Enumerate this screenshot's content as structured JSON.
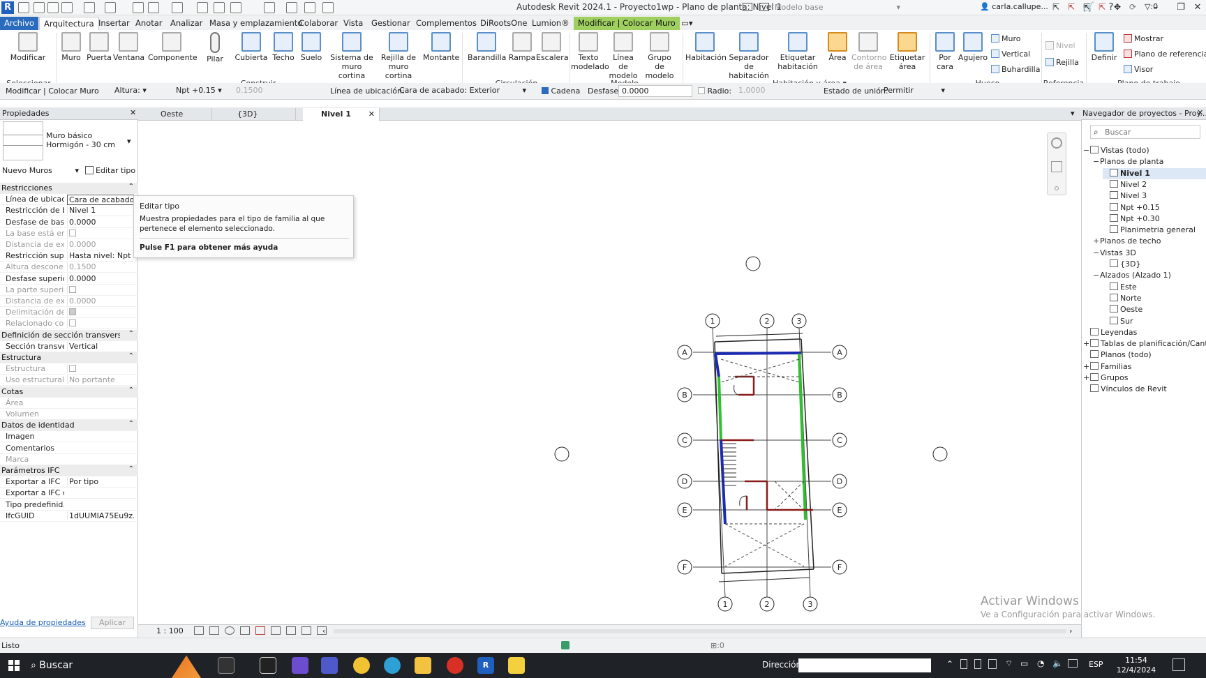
{
  "titlebar": {
    "title": "Autodesk Revit 2024.1 - Proyecto1wp - Plano de planta: Nivel 1",
    "user": "carla.callupe...",
    "logo": "R"
  },
  "menu": {
    "file": "Archivo",
    "tabs": [
      "Arquitectura",
      "Insertar",
      "Anotar",
      "Analizar",
      "Masa y emplazamiento",
      "Colaborar",
      "Vista",
      "Gestionar",
      "Complementos",
      "DiRootsOne",
      "Lumion®"
    ],
    "context_tab": "Modificar | Colocar Muro"
  },
  "ribbon": {
    "buttons": {
      "modificar": "Modificar",
      "muro": "Muro",
      "puerta": "Puerta",
      "ventana": "Ventana",
      "componente": "Componente",
      "pilar": "Pilar",
      "cubierta": "Cubierta",
      "techo": "Techo",
      "suelo": "Suelo",
      "sistema_muro": "Sistema de muro cortina",
      "rejilla_muro": "Rejilla de muro cortina",
      "montante": "Montante",
      "barandilla": "Barandilla",
      "rampa": "Rampa",
      "escalera": "Escalera",
      "texto_modelado": "Texto modelado",
      "linea_modelo": "Línea de modelo",
      "grupo_modelo": "Grupo de modelo",
      "habitacion": "Habitación",
      "separador": "Separador de habitación",
      "etiquetar_hab": "Etiquetar habitación",
      "area": "Área",
      "contorno_area": "Contorno de área",
      "etiquetar_area": "Etiquetar área",
      "por_cara": "Por cara",
      "agujero": "Agujero",
      "muro_small": "Muro",
      "vertical": "Vertical",
      "buhardilla": "Buhardilla",
      "nivel": "Nivel",
      "rejilla": "Rejilla",
      "definir": "Definir",
      "mostrar": "Mostrar",
      "plano_ref": "Plano de referencia",
      "visor": "Visor"
    },
    "panels": {
      "seleccionar": "Seleccionar",
      "construir": "Construir",
      "circulacion": "Circulación",
      "modelo": "Modelo",
      "habitacion_area": "Habitación y área",
      "hueco": "Hueco",
      "referencia": "Referencia",
      "plano_trabajo": "Plano de trabajo"
    }
  },
  "options": {
    "mode": "Modificar | Colocar Muro",
    "altura_label": "Altura:",
    "altura_value": "Npt +0.15",
    "height_value": "0.1500",
    "linea_label": "Línea de ubicación:",
    "linea_value": "Cara de acabado: Exterior",
    "cadena_label": "Cadena",
    "desfase_label": "Desfase:",
    "desfase_value": "0.0000",
    "radio_label": "Radio:",
    "radio_value": "1.0000",
    "union_label": "Estado de unión:",
    "union_value": "Permitir"
  },
  "properties": {
    "title": "Propiedades",
    "type_family": "Muro básico",
    "type_name": "Hormigón - 30 cm",
    "filter": "Nuevo Muros",
    "edit_type": "Editar tipo",
    "rows": [
      {
        "kind": "sec",
        "k": "Restricciones"
      },
      {
        "k": "Línea de ubicac...",
        "v": "Cara de acabado"
      },
      {
        "k": "Restricción de b...",
        "v": "Nivel 1"
      },
      {
        "k": "Desfase de base",
        "v": "0.0000"
      },
      {
        "k": "La base está enl...",
        "v": "",
        "cb": true,
        "dim": true
      },
      {
        "k": "Distancia de ext...",
        "v": "0.0000",
        "dim": true
      },
      {
        "k": "Restricción sup...",
        "v": "Hasta nivel: Npt ..."
      },
      {
        "k": "Altura descone...",
        "v": "0.1500",
        "dim": true
      },
      {
        "k": "Desfase superior",
        "v": "0.0000"
      },
      {
        "k": "La parte superio...",
        "v": "",
        "cb": true,
        "dim": true
      },
      {
        "k": "Distancia de ext...",
        "v": "0.0000",
        "dim": true
      },
      {
        "k": "Delimitación de...",
        "v": "",
        "cb": true,
        "dim": true
      },
      {
        "k": "Relacionado co...",
        "v": "",
        "cb": true,
        "dim": true
      },
      {
        "kind": "sec",
        "k": "Definición de sección transversal"
      },
      {
        "k": "Sección transve...",
        "v": "Vertical"
      },
      {
        "kind": "sec",
        "k": "Estructura"
      },
      {
        "k": "Estructura",
        "v": "",
        "cb": true,
        "dim": true
      },
      {
        "k": "Uso estructural",
        "v": "No portante",
        "dim": true
      },
      {
        "kind": "sec",
        "k": "Cotas"
      },
      {
        "k": "Área",
        "v": "",
        "dim": true
      },
      {
        "k": "Volumen",
        "v": "",
        "dim": true
      },
      {
        "kind": "sec",
        "k": "Datos de identidad"
      },
      {
        "k": "Imagen",
        "v": ""
      },
      {
        "k": "Comentarios",
        "v": ""
      },
      {
        "k": "Marca",
        "v": "",
        "dim": true
      },
      {
        "kind": "sec",
        "k": "Parámetros IFC"
      },
      {
        "k": "Exportar a IFC",
        "v": "Por tipo"
      },
      {
        "k": "Exportar a IFC c...",
        "v": ""
      },
      {
        "k": "Tipo predefinid...",
        "v": ""
      },
      {
        "k": "IfcGUID",
        "v": "1dUUMIA75Eu9z..."
      }
    ],
    "help_link": "Ayuda de propiedades",
    "apply": "Aplicar"
  },
  "tooltip": {
    "title": "Editar tipo",
    "body": "Muestra propiedades para el tipo de familia al que pertenece el elemento seleccionado.",
    "help": "Pulse F1 para obtener más ayuda"
  },
  "view_tabs": [
    "Oeste",
    "{3D}",
    "Nivel 1"
  ],
  "grids": {
    "cols_top": [
      "1",
      "2",
      "3"
    ],
    "cols_bottom": [
      "1",
      "2",
      "3"
    ],
    "rows": [
      "A",
      "B",
      "C",
      "D",
      "E",
      "F"
    ]
  },
  "browser": {
    "title": "Navegador de proyectos - Proy...",
    "search_placeholder": "Buscar",
    "nodes": [
      {
        "t": "Vistas (todo)",
        "d": 0,
        "pm": "−",
        "icon": true
      },
      {
        "t": "Planos de planta",
        "d": 1,
        "pm": "−"
      },
      {
        "t": "Nivel 1",
        "d": 2,
        "icon": true,
        "sel": true
      },
      {
        "t": "Nivel 2",
        "d": 2,
        "icon": true
      },
      {
        "t": "Nivel 3",
        "d": 2,
        "icon": true
      },
      {
        "t": "Npt +0.15",
        "d": 2,
        "icon": true
      },
      {
        "t": "Npt +0.30",
        "d": 2,
        "icon": true
      },
      {
        "t": "Planimetria general",
        "d": 2,
        "icon": true
      },
      {
        "t": "Planos de techo",
        "d": 1,
        "pm": "+"
      },
      {
        "t": "Vistas 3D",
        "d": 1,
        "pm": "−"
      },
      {
        "t": "{3D}",
        "d": 2,
        "icon": true
      },
      {
        "t": "Alzados (Alzado 1)",
        "d": 1,
        "pm": "−"
      },
      {
        "t": "Este",
        "d": 2,
        "icon": true
      },
      {
        "t": "Norte",
        "d": 2,
        "icon": true
      },
      {
        "t": "Oeste",
        "d": 2,
        "icon": true
      },
      {
        "t": "Sur",
        "d": 2,
        "icon": true
      },
      {
        "t": "Leyendas",
        "d": 0,
        "icon": true
      },
      {
        "t": "Tablas de planificación/Cantid",
        "d": 0,
        "pm": "+",
        "icon": true
      },
      {
        "t": "Planos (todo)",
        "d": 0,
        "icon": true
      },
      {
        "t": "Familias",
        "d": 0,
        "pm": "+",
        "icon": true
      },
      {
        "t": "Grupos",
        "d": 0,
        "pm": "+",
        "icon": true
      },
      {
        "t": "Vínculos de Revit",
        "d": 0,
        "icon": true
      }
    ]
  },
  "viewcontrol": {
    "scale": "1 : 100"
  },
  "status": {
    "left": "Listo",
    "zero1": ":0",
    "model": "Modelo base",
    "zero2": ":0"
  },
  "watermark": {
    "line1": "Activar Windows",
    "line2": "Ve a Configuración para activar Windows."
  },
  "taskbar": {
    "search": "Buscar",
    "direccion": "Dirección",
    "lang": "ESP",
    "time": "11:54",
    "date": "12/4/2024"
  },
  "colors": {
    "wall_blue": "#1a2bb0",
    "wall_green": "#2fbf2f",
    "wall_red": "#8b1a1a",
    "context_green": "#9ecf5f",
    "file_blue": "#2a6bbd"
  }
}
